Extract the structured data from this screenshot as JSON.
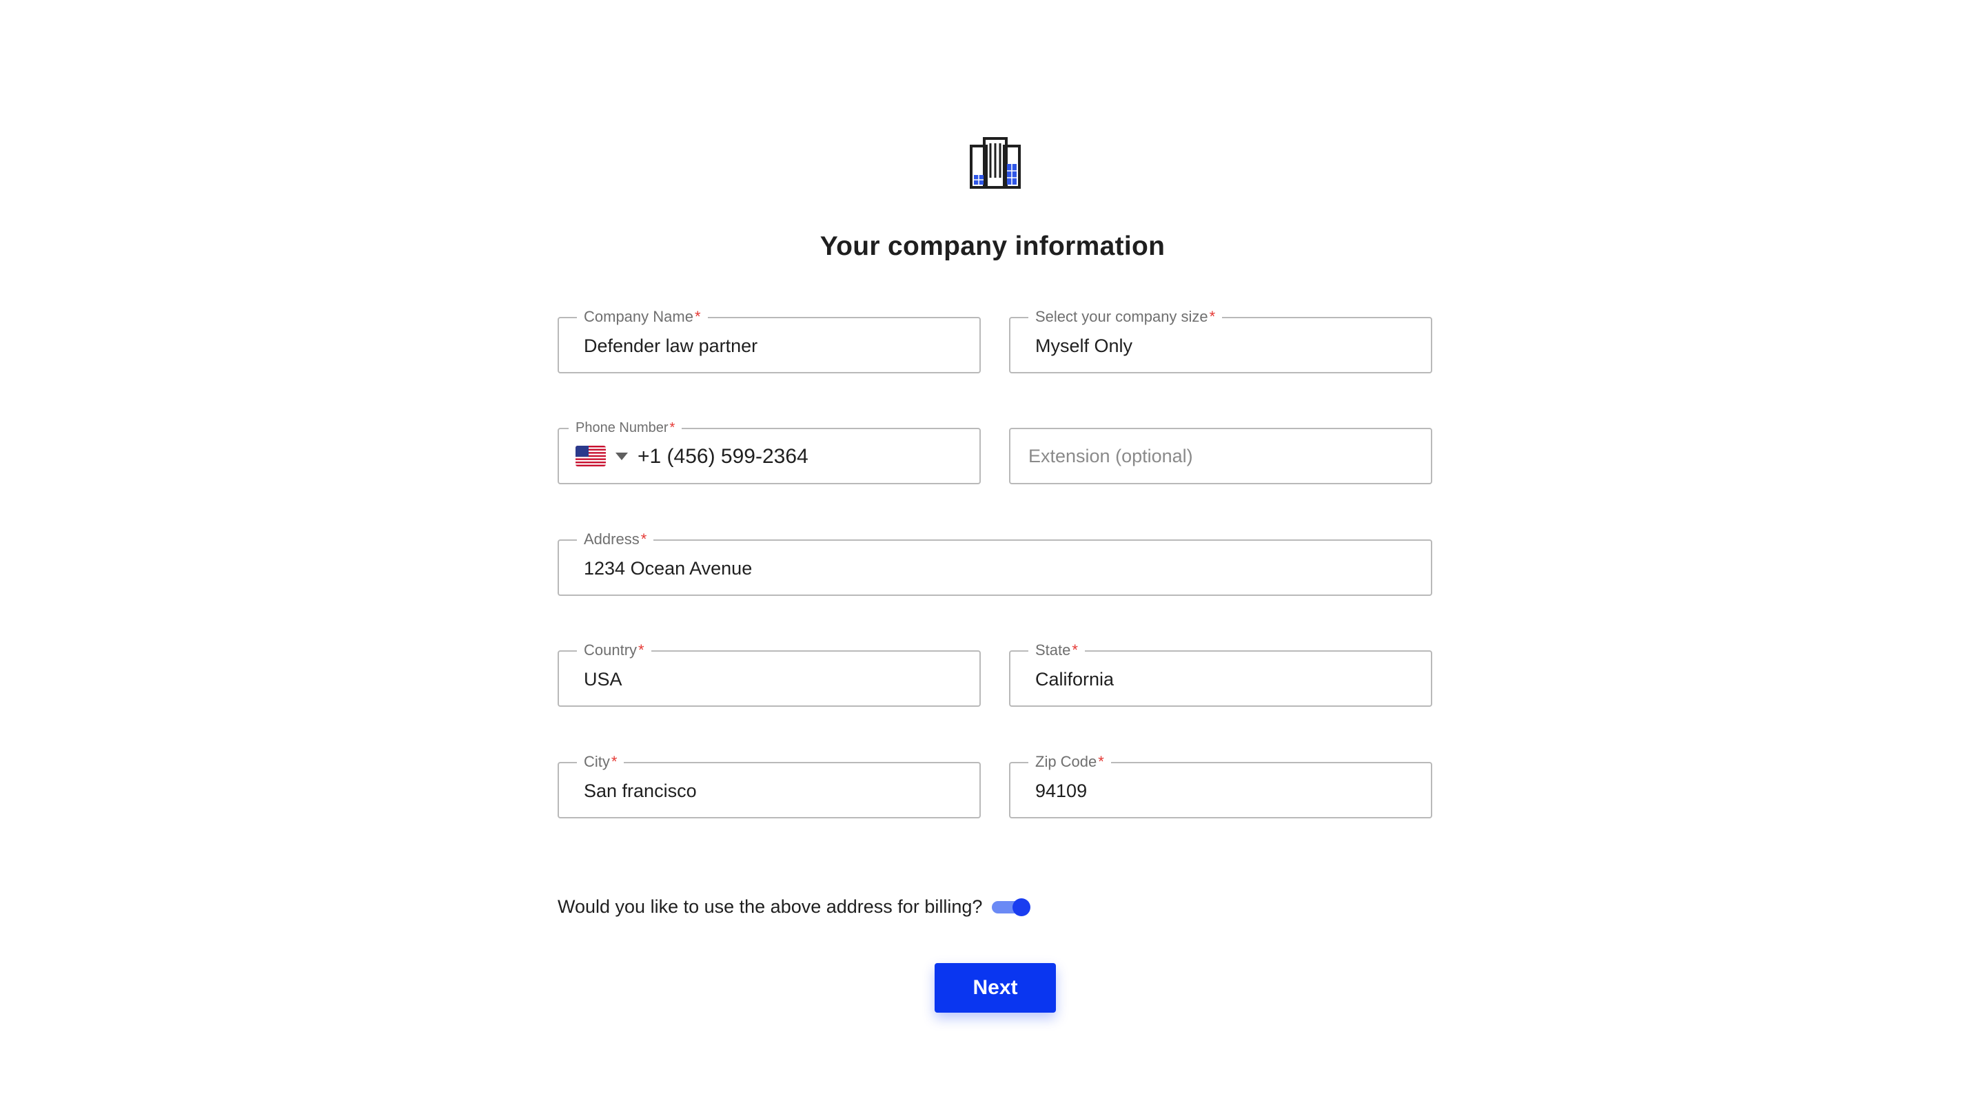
{
  "header": {
    "logo_icon": "building-icon",
    "title": "Your company information"
  },
  "form": {
    "company_name": {
      "label": "Company Name",
      "required_mark": "*",
      "value": "Defender law partner"
    },
    "company_size": {
      "label": "Select your company size",
      "required_mark": "*",
      "value": "Myself Only"
    },
    "phone": {
      "label": "Phone Number",
      "required_mark": "*",
      "country_flag": "us-flag-icon",
      "value": "+1 (456) 599-2364"
    },
    "extension": {
      "placeholder": "Extension (optional)"
    },
    "address": {
      "label": "Address",
      "required_mark": "*",
      "value": "1234 Ocean Avenue"
    },
    "country": {
      "label": "Country",
      "required_mark": "*",
      "value": "USA"
    },
    "state": {
      "label": "State",
      "required_mark": "*",
      "value": "California"
    },
    "city": {
      "label": "City",
      "required_mark": "*",
      "value": "San francisco"
    },
    "zip": {
      "label": "Zip Code",
      "required_mark": "*",
      "value": "94109"
    }
  },
  "billing": {
    "question": "Would you like to use the above address for billing?",
    "toggle_on": true
  },
  "actions": {
    "next_label": "Next"
  },
  "colors": {
    "accent": "#0a36f0",
    "required": "#e53935",
    "border": "#b9b9b9"
  }
}
